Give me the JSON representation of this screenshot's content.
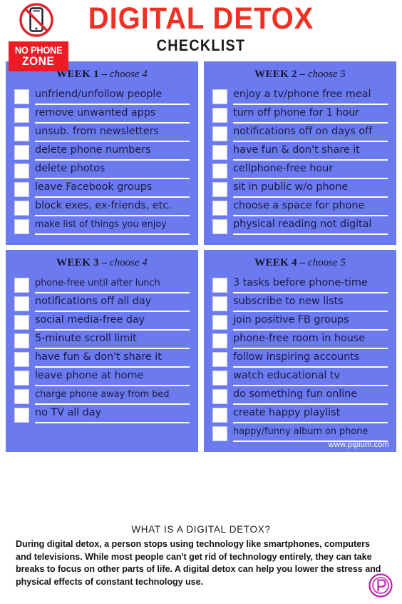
{
  "header": {
    "title": "DIGITAL DETOX",
    "subtitle": "CHECKLIST",
    "badge": {
      "line1": "NO PHONE",
      "line2": "ZONE",
      "icon": "no-phone-prohibition-icon"
    },
    "title_color": "#EE3124",
    "subtitle_color": "#1A1A1A",
    "badge_color": "#ED1C24"
  },
  "theme": {
    "panel_background": "#6B7AEE",
    "panel_text": "#1B1B45",
    "underline": "#ffffff",
    "page_background": "#ffffff",
    "logo_color": "#C21DAF"
  },
  "weeks": [
    {
      "week_label": "WEEK 1",
      "dash": "–",
      "choose": "choose 4",
      "items": [
        "unfriend/unfollow people",
        "remove unwanted apps",
        "unsub. from newsletters",
        "delete phone numbers",
        "delete photos",
        "leave Facebook groups",
        "block exes, ex-friends, etc.",
        "make list of things you enjoy"
      ]
    },
    {
      "week_label": "WEEK 2",
      "dash": "–",
      "choose": "choose 5",
      "items": [
        "enjoy a tv/phone free meal",
        "turn off phone for 1 hour",
        "notifications off on days off",
        "have fun & don't share it",
        "cellphone-free hour",
        "sit in public w/o phone",
        "choose a space for phone",
        "physical reading not digital"
      ]
    },
    {
      "week_label": "WEEK 3",
      "dash": "–",
      "choose": "choose 4",
      "items": [
        "phone-free until after lunch",
        "notifications off all day",
        "social media-free day",
        "5-minute scroll limit",
        "have fun & don't share it",
        "leave phone at home",
        "charge phone away from bed",
        "no TV all day"
      ]
    },
    {
      "week_label": "WEEK 4",
      "dash": "–",
      "choose": "choose 5",
      "items": [
        "3 tasks before phone-time",
        "subscribe to new lists",
        "join positive FB groups",
        "phone-free room in house",
        "follow inspiring accounts",
        "watch educational tv",
        "do something fun online",
        "create happy playlist",
        "happy/funny album on phone"
      ],
      "credit": "www.piplum.com"
    }
  ],
  "footer": {
    "heading": "WHAT IS A DIGITAL DETOX?",
    "body": "During digital detox, a person stops using technology like smartphones, computers and televisions. While most people can't get rid of technology entirely, they can take breaks to focus on other parts of life. A digital detox can help you lower the stress and physical effects of constant technology use.",
    "logo": "piplum-p-logo"
  }
}
